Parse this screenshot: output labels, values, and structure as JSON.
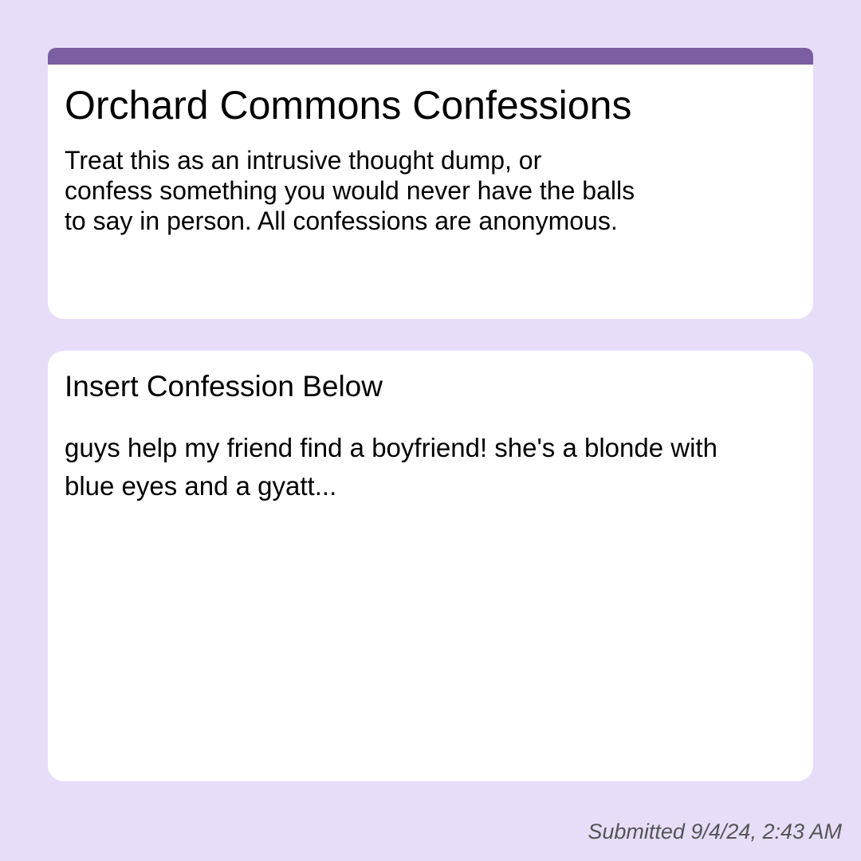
{
  "form": {
    "accent_color": "#7b5fa2",
    "background_color": "#e7ddf9",
    "title": "Orchard Commons Confessions",
    "description_lines": [
      "Treat this as an intrusive thought dump, or",
      "confess something you would never have the balls",
      "to say in person. All confessions are anonymous."
    ]
  },
  "question": {
    "label": "Insert Confession Below",
    "answer_lines": [
      "guys help my friend find a boyfriend! she's a blonde with",
      "blue eyes and a gyatt..."
    ]
  },
  "footer": {
    "submitted": "Submitted 9/4/24, 2:43 AM"
  }
}
